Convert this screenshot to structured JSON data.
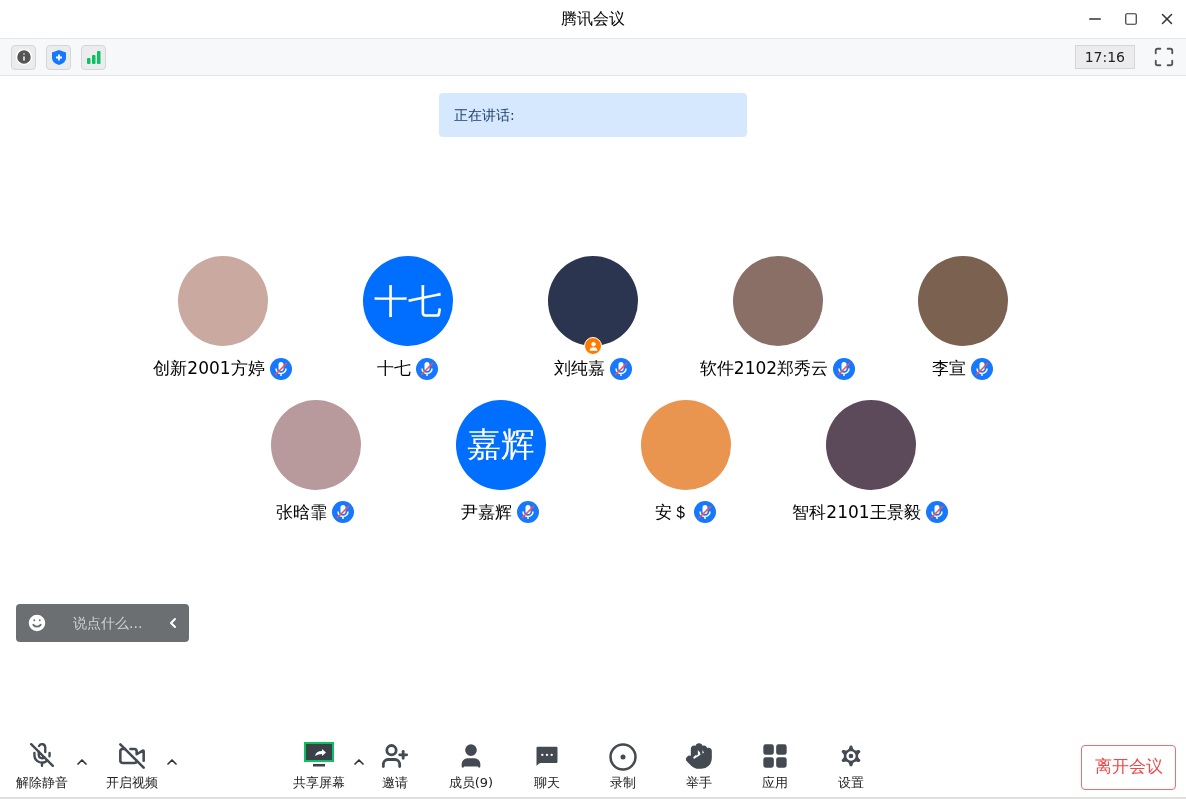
{
  "window": {
    "title": "腾讯会议"
  },
  "info_bar": {
    "time": "17:16"
  },
  "speaking": {
    "label": "正在讲话:"
  },
  "participant_rows": [
    [
      {
        "name": "创新2001方婷",
        "kind": "photo",
        "color": "#c9a9a0",
        "muted": true,
        "host": false
      },
      {
        "name": "十七",
        "kind": "initials",
        "initials": "十七",
        "muted": true,
        "host": false
      },
      {
        "name": "刘纯嘉",
        "kind": "photo",
        "color": "#2b3550",
        "muted": true,
        "host": true
      },
      {
        "name": "软件2102郑秀云",
        "kind": "photo",
        "color": "#8a6f66",
        "muted": true,
        "host": false
      },
      {
        "name": "李宣",
        "kind": "photo",
        "color": "#7a6150",
        "muted": true,
        "host": false
      }
    ],
    [
      {
        "name": "张晗霏",
        "kind": "photo",
        "color": "#b89a9c",
        "muted": true,
        "host": false
      },
      {
        "name": "尹嘉辉",
        "kind": "initials",
        "initials": "嘉辉",
        "muted": true,
        "host": false
      },
      {
        "name": "安＄",
        "kind": "photo",
        "color": "#e9954f",
        "muted": true,
        "host": false
      },
      {
        "name": "智科2101王景毅",
        "kind": "photo",
        "color": "#5c4a5a",
        "muted": true,
        "host": false
      }
    ]
  ],
  "chat_input": {
    "placeholder": "说点什么..."
  },
  "toolbar": [
    {
      "kind": "mic",
      "label": "解除静音",
      "menu": true
    },
    {
      "kind": "video",
      "label": "开启视频",
      "menu": true
    },
    {
      "kind": "share",
      "label": "共享屏幕",
      "menu": true
    },
    {
      "kind": "invite",
      "label": "邀请",
      "menu": false
    },
    {
      "kind": "members",
      "label": "成员(9)",
      "menu": false
    },
    {
      "kind": "chat",
      "label": "聊天",
      "menu": false
    },
    {
      "kind": "record",
      "label": "录制",
      "menu": false
    },
    {
      "kind": "hand",
      "label": "举手",
      "menu": false
    },
    {
      "kind": "apps",
      "label": "应用",
      "menu": false
    },
    {
      "kind": "settings",
      "label": "设置",
      "menu": false
    }
  ],
  "leave_button": {
    "label": "离开会议"
  }
}
